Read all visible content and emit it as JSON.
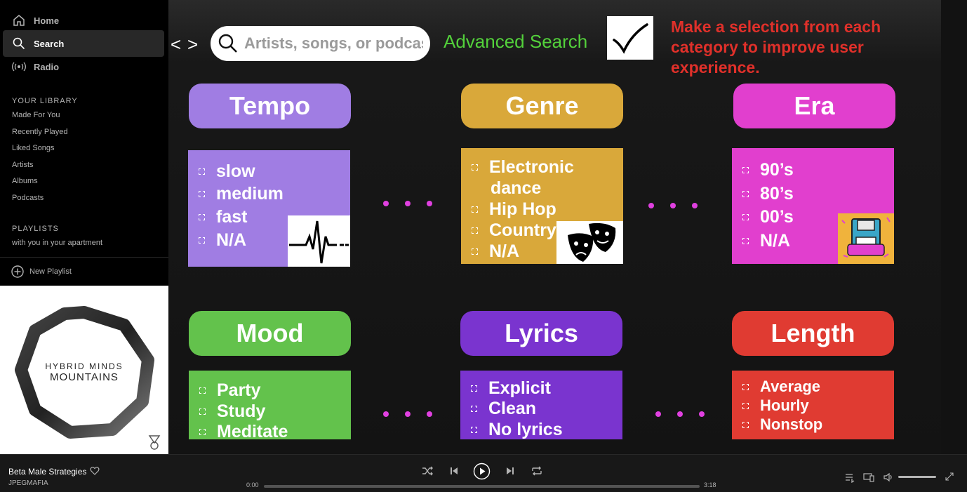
{
  "sidebar": {
    "nav": [
      {
        "label": "Home",
        "icon": "home-icon"
      },
      {
        "label": "Search",
        "icon": "search-icon",
        "active": true
      },
      {
        "label": "Radio",
        "icon": "radio-icon"
      }
    ],
    "library_title": "YOUR LIBRARY",
    "library": [
      "Made For You",
      "Recently Played",
      "Liked Songs",
      "Artists",
      "Albums",
      "Podcasts"
    ],
    "playlists_title": "PLAYLISTS",
    "playlists": [
      "with you in your apartment"
    ],
    "new_playlist": "New Playlist"
  },
  "album_art": {
    "line1": "HYBRID MINDS",
    "line2": "MOUNTAINS"
  },
  "topbar": {
    "back": "<",
    "forward": ">",
    "search_placeholder": "Artists, songs, or podcasts",
    "advanced_search": "Advanced Search",
    "notice": "Make a selection from each category to improve user experience."
  },
  "categories": [
    {
      "title": "Tempo",
      "color": "#a07de3",
      "options": [
        "slow",
        "medium",
        "fast",
        "N/A"
      ],
      "image": "heartbeat-icon"
    },
    {
      "title": "Genre",
      "color": "#d9a83a",
      "options": [
        "Electronic",
        "dance",
        "Hip Hop",
        "Country",
        "N/A"
      ],
      "image": "theater-masks-icon"
    },
    {
      "title": "Era",
      "color": "#e13fce",
      "options": [
        "90’s",
        "80’s",
        "00’s",
        "N/A"
      ],
      "image": "90s-forever-icon"
    },
    {
      "title": "Mood",
      "color": "#63c24c",
      "options": [
        "Party",
        "Study",
        "Meditate"
      ]
    },
    {
      "title": "Lyrics",
      "color": "#7a34cf",
      "options": [
        "Explicit",
        "Clean",
        "No lyrics"
      ]
    },
    {
      "title": "Length",
      "color": "#e03b32",
      "options": [
        "Average",
        "Hourly",
        "Nonstop"
      ]
    }
  ],
  "colors": {
    "ellipsis": "#e040e0",
    "advanced_search": "#53d13b",
    "notice": "#e0302a"
  },
  "player": {
    "track": "Beta Male Strategies",
    "artist": "JPEGMAFIA",
    "elapsed": "0:00",
    "duration": "3:18",
    "progress": 0,
    "volume": 1.0
  }
}
